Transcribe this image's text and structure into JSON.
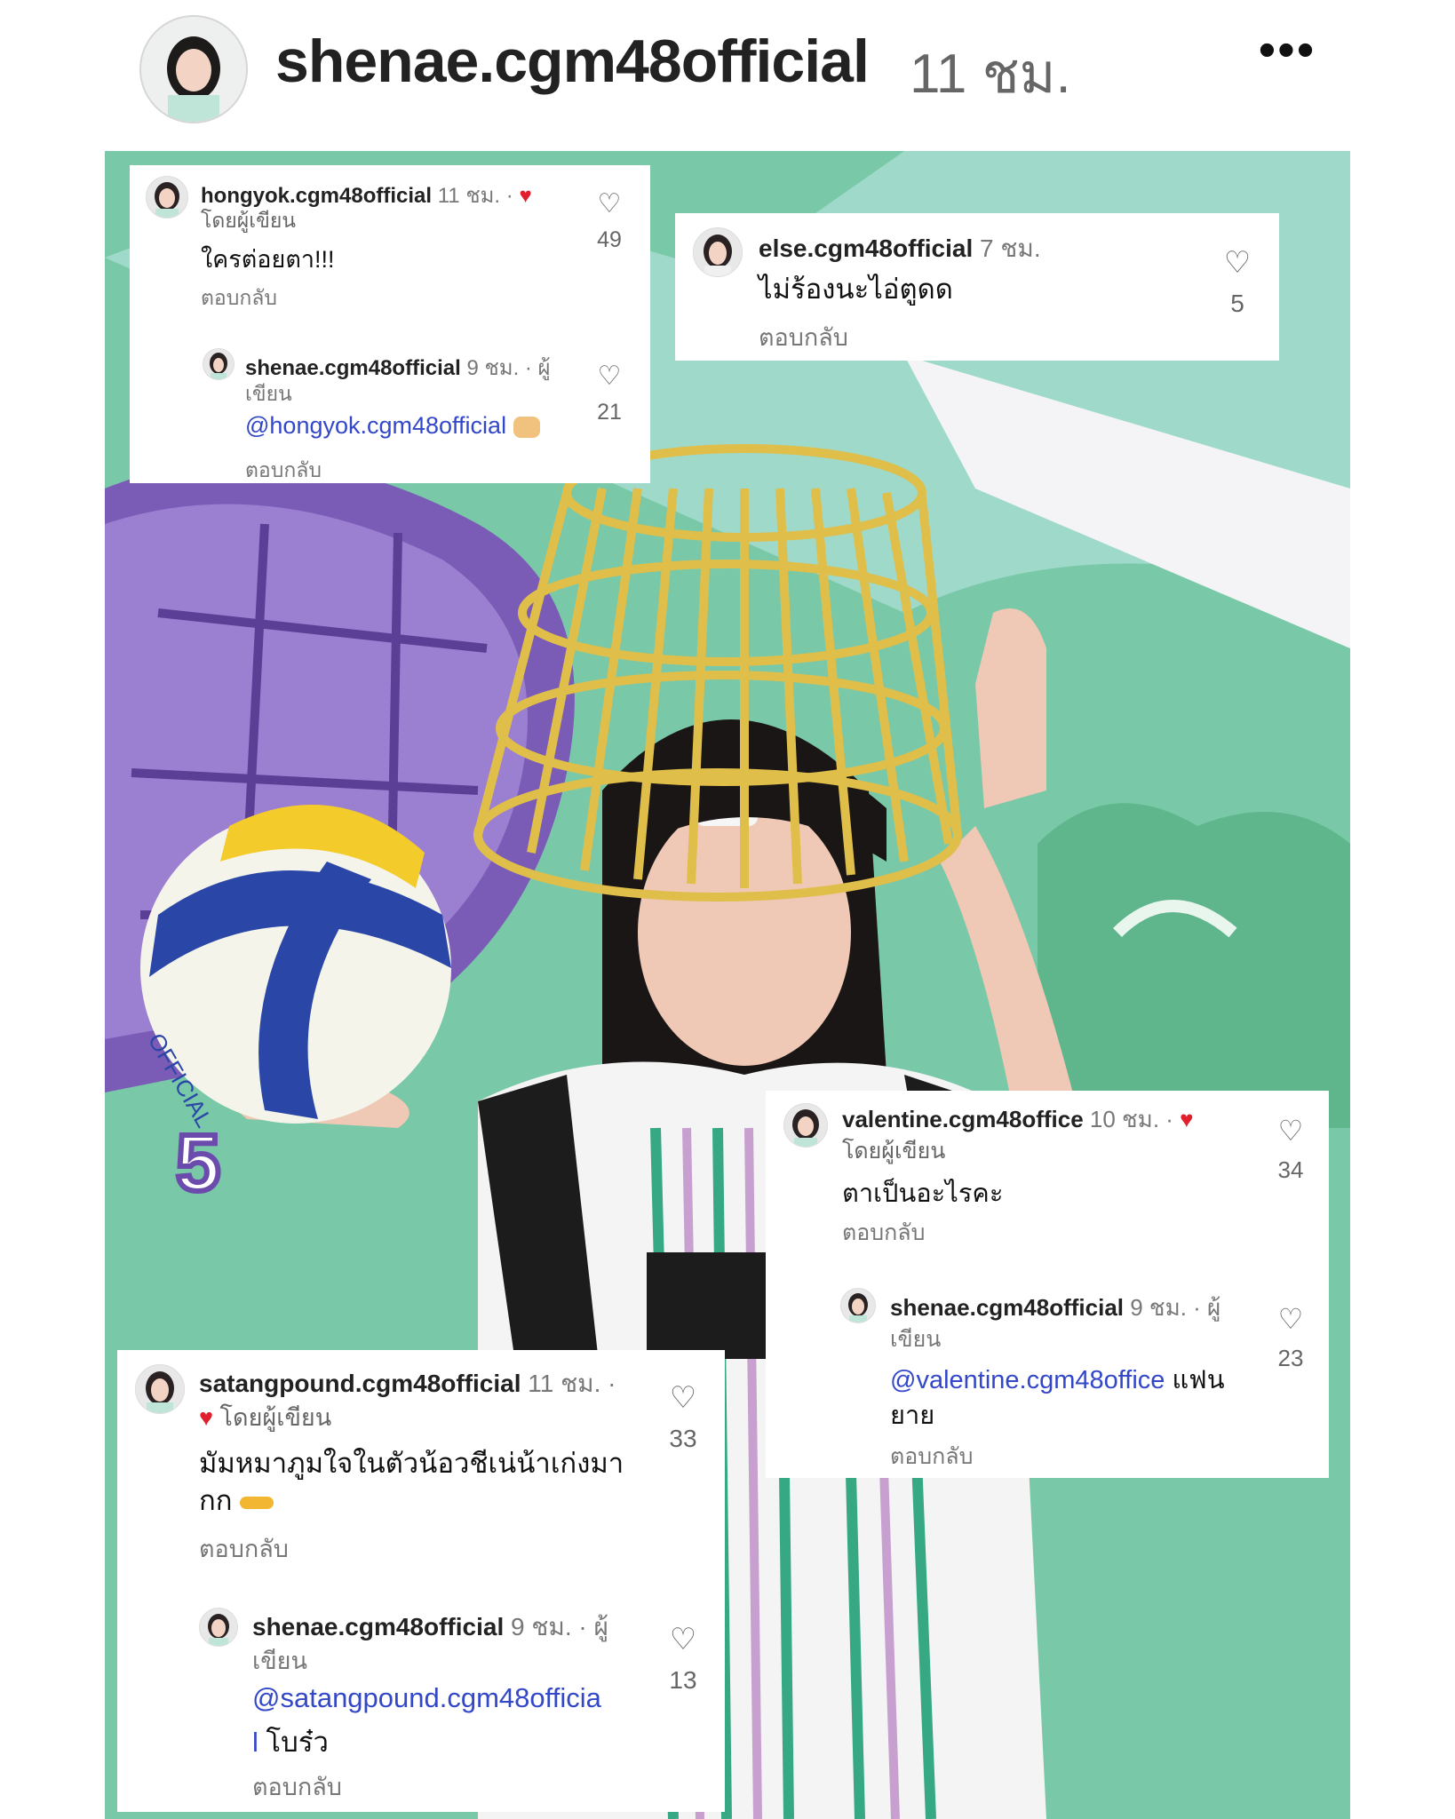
{
  "header": {
    "username": "shenae.cgm48official",
    "time": "11 ชม.",
    "more_label": "•••"
  },
  "cards": {
    "c1": {
      "comment": {
        "user": "hongyok.cgm48official",
        "time": "11 ชม. ·",
        "sub": "โดยผู้เขียน",
        "text": "ใครต่อยตา!!!",
        "reply": "ตอบกลับ",
        "likes": "49"
      },
      "reply": {
        "user": "shenae.cgm48official",
        "time": "9 ชม. · ผู้",
        "time2": "เขียน",
        "mention": "@hongyok.cgm48official",
        "reply": "ตอบกลับ",
        "likes": "21"
      }
    },
    "c2": {
      "comment": {
        "user": "else.cgm48official",
        "time": "7 ชม.",
        "text": "ไม่ร้องนะไอ่ตูดด",
        "reply": "ตอบกลับ",
        "likes": "5"
      }
    },
    "c3": {
      "comment": {
        "user": "valentine.cgm48office",
        "time": "10 ชม. ·",
        "sub": "โดยผู้เขียน",
        "text": "ตาเป็นอะไรคะ",
        "reply": "ตอบกลับ",
        "likes": "34"
      },
      "reply": {
        "user": "shenae.cgm48official",
        "time": "9 ชม. · ผู้",
        "time2": "เขียน",
        "mention": "@valentine.cgm48office",
        "text_a": "แฟน",
        "text_b": "ยาย",
        "reply": "ตอบกลับ",
        "likes": "23"
      }
    },
    "c4": {
      "comment": {
        "user": "satangpound.cgm48official",
        "time": "11 ชม. ·",
        "sub": "โดยผู้เขียน",
        "text_a": "มัมหมาภูมใจในตัวน้อวชีเน่น้าเก่งมา",
        "text_b": "กก",
        "reply": "ตอบกลับ",
        "likes": "33"
      },
      "reply": {
        "user": "shenae.cgm48official",
        "time": "9 ชม. · ผู้",
        "time2": "เขียน",
        "mention_a": "@satangpound.cgm48officia",
        "mention_b": "l",
        "text": "โบร๋ว",
        "reply": "ตอบกลับ",
        "likes": "13"
      }
    }
  },
  "photo": {
    "ball_text": "OFFICIAL",
    "jersey_text": "5"
  }
}
